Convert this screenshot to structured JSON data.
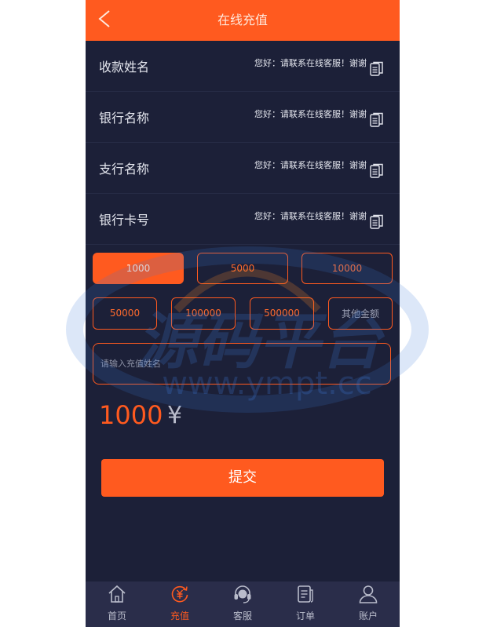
{
  "header": {
    "title": "在线充值",
    "back_icon": "chevron-left-icon"
  },
  "info_rows": [
    {
      "label": "收款姓名",
      "value": "您好：请联系在线客服！谢谢",
      "icon": "copy-icon"
    },
    {
      "label": "银行名称",
      "value": "您好：请联系在线客服！谢谢",
      "icon": "copy-icon"
    },
    {
      "label": "支行名称",
      "value": "您好：请联系在线客服！谢谢",
      "icon": "copy-icon"
    },
    {
      "label": "银行卡号",
      "value": "您好：请联系在线客服！谢谢",
      "icon": "copy-icon"
    }
  ],
  "amount_options": [
    "1000",
    "5000",
    "10000",
    "50000",
    "100000",
    "500000"
  ],
  "selected_amount_option": "1000",
  "other_amount_placeholder": "其他金额",
  "name_input_placeholder": "请输入充值姓名",
  "amount_display": {
    "value": "1000",
    "currency": "¥"
  },
  "submit_label": "提交",
  "tabs": [
    {
      "label": "首页",
      "icon": "home-icon",
      "active": false
    },
    {
      "label": "充值",
      "icon": "recharge-icon",
      "active": true
    },
    {
      "label": "客服",
      "icon": "headset-icon",
      "active": false
    },
    {
      "label": "订单",
      "icon": "order-icon",
      "active": false
    },
    {
      "label": "账户",
      "icon": "user-icon",
      "active": false
    }
  ],
  "watermark": {
    "brand": "源码平台",
    "url": "www.ympt.cc"
  },
  "colors": {
    "accent": "#ff5a1f",
    "background": "#1c2038",
    "tabbar": "#2a2d4a"
  }
}
